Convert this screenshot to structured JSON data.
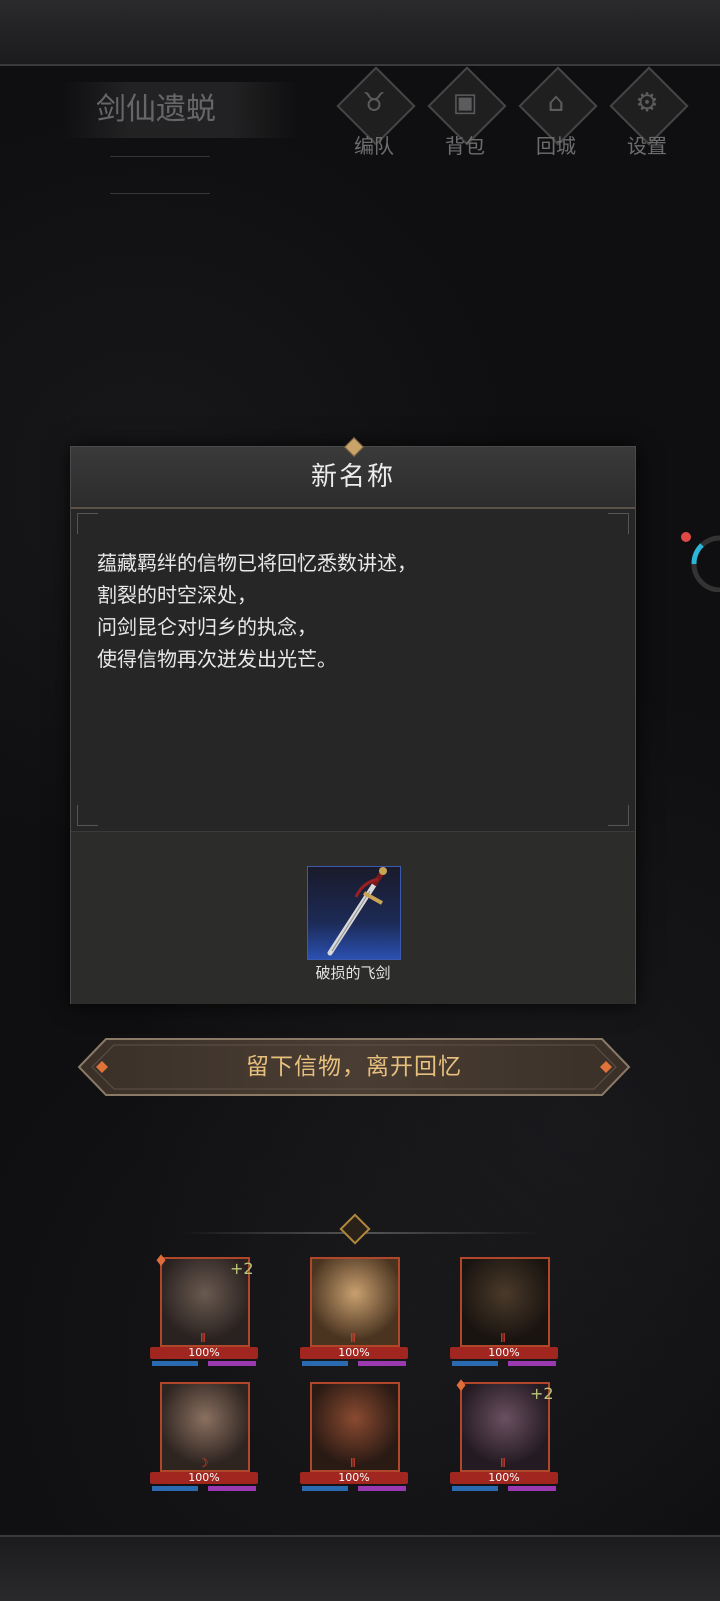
{
  "header": {
    "map_title": "剑仙遗蜕",
    "menu": [
      {
        "label": "编队",
        "icon": "ox-head-icon"
      },
      {
        "label": "背包",
        "icon": "bag-icon"
      },
      {
        "label": "回城",
        "icon": "door-icon"
      },
      {
        "label": "设置",
        "icon": "gear-icon"
      }
    ]
  },
  "dialog": {
    "title": "新名称",
    "lines": [
      "蕴藏羁绊的信物已将回忆悉数讲述，",
      "割裂的时空深处，",
      "问剑昆仑对归乡的执念，",
      "使得信物再次迸发出光芒。"
    ],
    "reward": {
      "name": "破损的飞剑",
      "icon": "flying-sword-icon"
    }
  },
  "action": {
    "leave_label": "留下信物，离开回忆"
  },
  "team": {
    "heroes": [
      {
        "hp": "100%",
        "plus": "+2",
        "rank": true
      },
      {
        "hp": "100%",
        "plus": "",
        "rank": false
      },
      {
        "hp": "100%",
        "plus": "",
        "rank": false
      },
      {
        "hp": "100%",
        "plus": "",
        "rank": false
      },
      {
        "hp": "100%",
        "plus": "",
        "rank": false
      },
      {
        "hp": "100%",
        "plus": "+2",
        "rank": true
      }
    ]
  },
  "colors": {
    "accent_gold": "#e7c07e",
    "hp_red": "#a0261f",
    "mp_blue": "#2a6ab0",
    "sp_purple": "#9b3ab0"
  }
}
